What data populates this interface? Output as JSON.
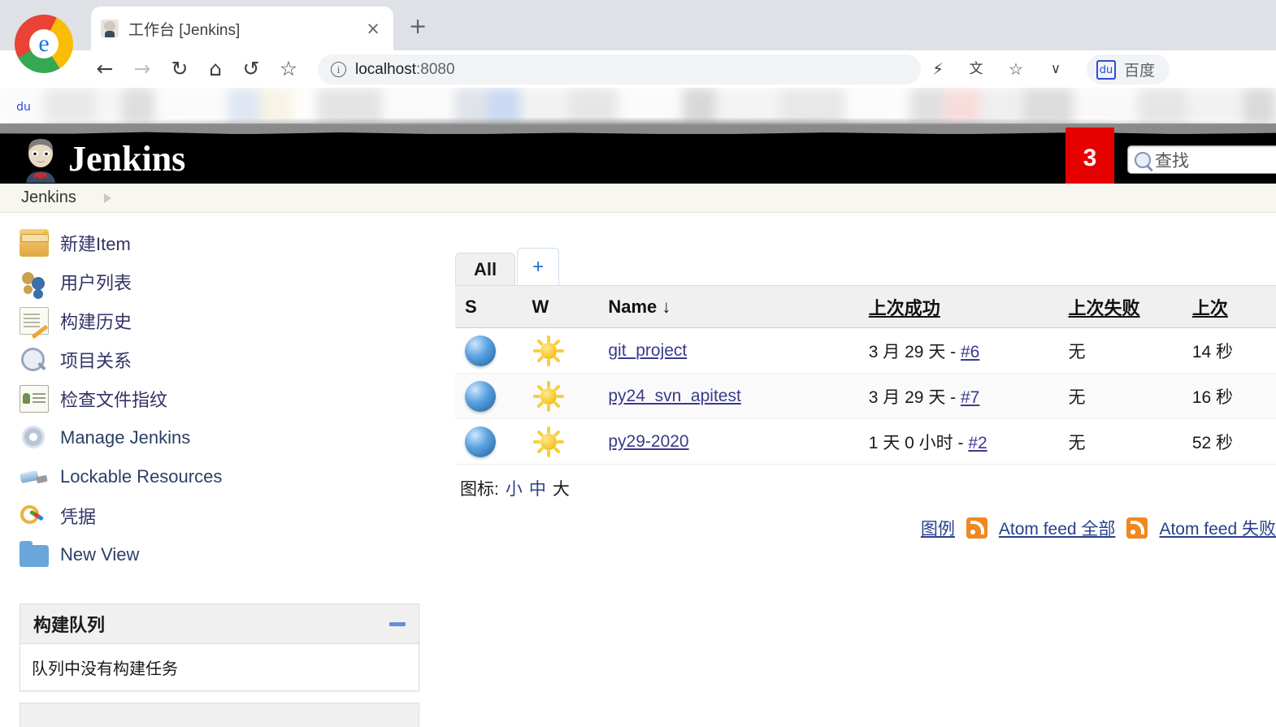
{
  "browser": {
    "tab": {
      "title": "工作台 [Jenkins]",
      "favicon": "jenkins-butler-icon",
      "close_label": "×"
    },
    "new_tab_label": "+",
    "nav": {
      "back": "←",
      "forward": "→",
      "reload": "↻",
      "home": "⌂",
      "history_back": "↺",
      "bookmark": "☆"
    },
    "omnibox": {
      "url_host": "localhost",
      "url_port": ":8080",
      "info_icon": "i"
    },
    "toolbar_icons": {
      "lightning": "⚡",
      "translate": "文",
      "star": "☆",
      "chevron": "∨"
    },
    "baidu_chip": {
      "label": "百度",
      "paw_icon": "baidu-paw-icon"
    },
    "bookmarks_bar": {
      "baidu_icon": "baidu-paw-icon"
    }
  },
  "jenkins": {
    "brand": "Jenkins",
    "notification_count": "3",
    "search": {
      "placeholder": "查找",
      "icon": "search-icon"
    },
    "breadcrumb": {
      "root": "Jenkins"
    },
    "sidebar": {
      "items": [
        {
          "label": "新建Item",
          "icon": "new-item-icon"
        },
        {
          "label": "用户列表",
          "icon": "people-icon"
        },
        {
          "label": "构建历史",
          "icon": "history-icon"
        },
        {
          "label": "项目关系",
          "icon": "search-icon"
        },
        {
          "label": "检查文件指纹",
          "icon": "fingerprint-card-icon"
        },
        {
          "label": "Manage Jenkins",
          "icon": "gear-icon"
        },
        {
          "label": "Lockable Resources",
          "icon": "usb-icon"
        },
        {
          "label": "凭据",
          "icon": "keys-icon"
        },
        {
          "label": "New View",
          "icon": "folder-icon"
        }
      ]
    },
    "build_queue": {
      "title": "构建队列",
      "minimize_label": "—",
      "empty_text": "队列中没有构建任务"
    },
    "views": {
      "tabs": [
        {
          "label": "All",
          "active": true
        },
        {
          "label": "+",
          "active": false
        }
      ]
    },
    "jobs_table": {
      "columns": [
        "S",
        "W",
        "Name ↓",
        "上次成功",
        "上次失败",
        "上次"
      ],
      "rows": [
        {
          "status_icon": "blue-ball-icon",
          "weather_icon": "sunny-icon",
          "name": "git_project",
          "last_success": "3 月 29 天 - ",
          "last_success_build": "#6",
          "last_failure": "无",
          "last_duration": "14 秒"
        },
        {
          "status_icon": "blue-ball-icon",
          "weather_icon": "sunny-icon",
          "name": "py24_svn_apitest",
          "last_success": "3 月 29 天 - ",
          "last_success_build": "#7",
          "last_failure": "无",
          "last_duration": "16 秒"
        },
        {
          "status_icon": "blue-ball-icon",
          "weather_icon": "sunny-icon",
          "name": "py29-2020",
          "last_success": "1 天 0 小时 - ",
          "last_success_build": "#2",
          "last_failure": "无",
          "last_duration": "52 秒"
        }
      ]
    },
    "icon_size": {
      "label": "图标:",
      "options": [
        {
          "label": "小",
          "current": false
        },
        {
          "label": "中",
          "current": false
        },
        {
          "label": "大",
          "current": true
        }
      ]
    },
    "footer_links": {
      "legend": "图例",
      "feed_all": "Atom feed 全部",
      "feed_failed": "Atom feed 失败"
    }
  }
}
